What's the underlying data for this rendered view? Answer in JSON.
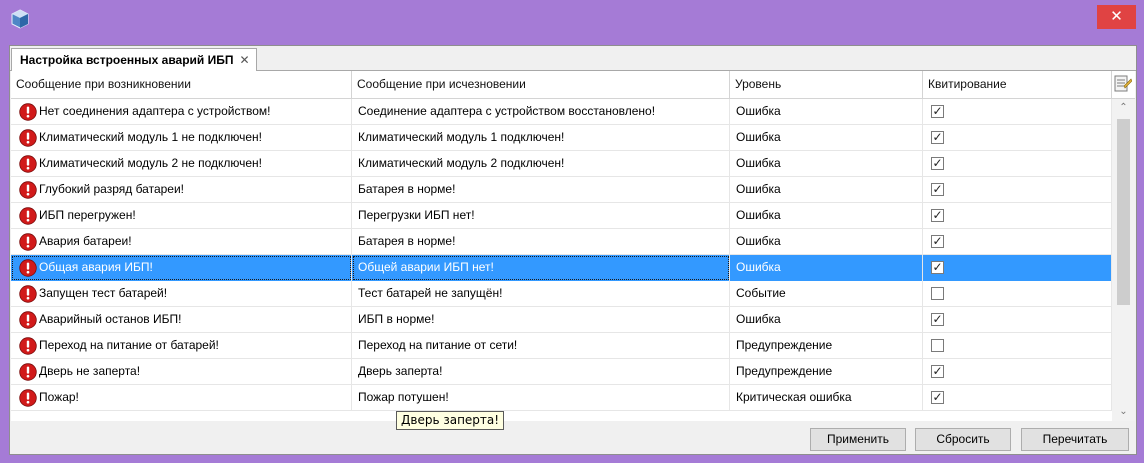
{
  "window": {
    "tab_title": "Настройка встроенных аварий ИБП",
    "tab_close": "✕",
    "close_glyph": "✕"
  },
  "grid": {
    "columns": [
      "Сообщение при возникновении",
      "Сообщение при исчезновении",
      "Уровень",
      "Квитирование"
    ],
    "rows": [
      {
        "on": "Нет соединения адаптера с устройством!",
        "off": "Соединение адаптера с устройством восстановлено!",
        "level": "Ошибка",
        "ack": true
      },
      {
        "on": "Климатический модуль 1 не подключен!",
        "off": "Климатический модуль 1 подключен!",
        "level": "Ошибка",
        "ack": true
      },
      {
        "on": "Климатический модуль 2 не подключен!",
        "off": "Климатический модуль 2 подключен!",
        "level": "Ошибка",
        "ack": true
      },
      {
        "on": "Глубокий разряд батареи!",
        "off": "Батарея в норме!",
        "level": "Ошибка",
        "ack": true
      },
      {
        "on": "ИБП перегружен!",
        "off": "Перегрузки ИБП нет!",
        "level": "Ошибка",
        "ack": true
      },
      {
        "on": "Авария батареи!",
        "off": "Батарея в норме!",
        "level": "Ошибка",
        "ack": true
      },
      {
        "on": "Общая авария ИБП!",
        "off": "Общей аварии ИБП нет!",
        "level": "Ошибка",
        "ack": true,
        "selected": true
      },
      {
        "on": "Запущен тест батарей!",
        "off": "Тест батарей не запущён!",
        "level": "Событие",
        "ack": false
      },
      {
        "on": "Аварийный останов ИБП!",
        "off": "ИБП в норме!",
        "level": "Ошибка",
        "ack": true
      },
      {
        "on": "Переход на питание от батарей!",
        "off": "Переход на питание от сети!",
        "level": "Предупреждение",
        "ack": false
      },
      {
        "on": "Дверь не заперта!",
        "off": "Дверь заперта!",
        "level": "Предупреждение",
        "ack": true
      },
      {
        "on": "Пожар!",
        "off": "Пожар потушен!",
        "level": "Критическая ошибка",
        "ack": true
      }
    ],
    "row_icon": "alert-icon",
    "check_glyph": "✓"
  },
  "buttons": {
    "apply": "Применить",
    "reset": "Сбросить",
    "reread": "Перечитать"
  },
  "tooltip": {
    "text": "Дверь заперта!"
  },
  "colors": {
    "titlebar": "#a57bd6",
    "selection": "#3399ff",
    "alert_red": "#d11a1a",
    "close_red": "#e04343"
  }
}
